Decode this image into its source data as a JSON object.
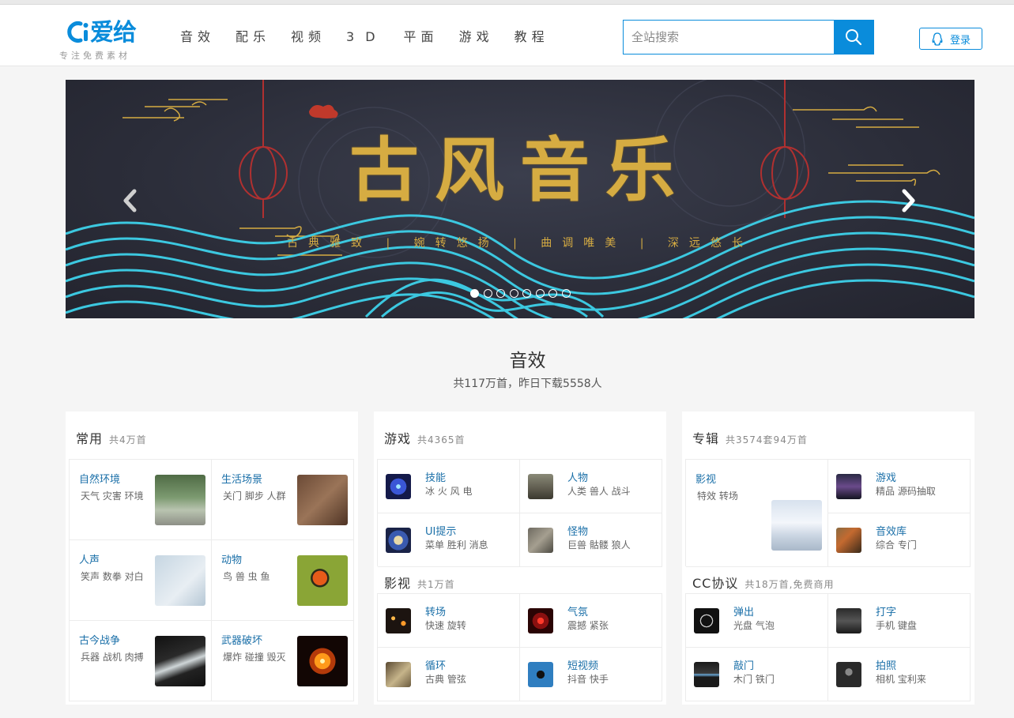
{
  "header": {
    "logo_text": "爱给",
    "logo_tagline": "专注免费素材",
    "nav": [
      "音效",
      "配乐",
      "视频",
      "3D",
      "平面",
      "游戏",
      "教程"
    ],
    "search_placeholder": "全站搜索",
    "login_label": "登录"
  },
  "banner": {
    "title": "古风音乐",
    "subtitle": "古典雅致 | 婉转悠扬 | 曲调唯美 | 深远悠长",
    "slide_count": 8,
    "active_slide": 1
  },
  "section": {
    "title": "音效",
    "stats": "共117万首，昨日下载5558人"
  },
  "panels": [
    {
      "heading": "常用",
      "count": "共4万首",
      "items": [
        {
          "title": "自然环境",
          "tags": "天气 灾害 环境",
          "icon": "forest-path-thumb"
        },
        {
          "title": "生活场景",
          "tags": "关门 脚步 人群",
          "icon": "footsteps-thumb"
        },
        {
          "title": "人声",
          "tags": "笑声 数拳 对白",
          "icon": "voice-thumb"
        },
        {
          "title": "动物",
          "tags": "鸟 兽 虫 鱼",
          "icon": "ladybug-thumb"
        },
        {
          "title": "古今战争",
          "tags": "兵器 战机 肉搏",
          "icon": "blade-thumb"
        },
        {
          "title": "武器破坏",
          "tags": "爆炸 碰撞 毁灭",
          "icon": "explosion-thumb"
        }
      ]
    },
    {
      "heading": "游戏",
      "count": "共4365首",
      "items": [
        {
          "title": "技能",
          "tags": "冰 火 风 电",
          "icon": "skill-icon"
        },
        {
          "title": "人物",
          "tags": "人类 兽人 战斗",
          "icon": "character-icon"
        },
        {
          "title": "UI提示",
          "tags": "菜单 胜利 消息",
          "icon": "ui-icon"
        },
        {
          "title": "怪物",
          "tags": "巨兽 骷髅 狼人",
          "icon": "monster-icon"
        }
      ],
      "sub_heading": "影视",
      "sub_count": "共1万首",
      "sub_items": [
        {
          "title": "转场",
          "tags": "快速 旋转",
          "icon": "transition-icon"
        },
        {
          "title": "气氛",
          "tags": "震撼 紧张",
          "icon": "atmosphere-icon"
        },
        {
          "title": "循环",
          "tags": "古典 管弦",
          "icon": "loop-icon"
        },
        {
          "title": "短视频",
          "tags": "抖音 快手",
          "icon": "short-video-icon"
        }
      ]
    },
    {
      "heading": "专辑",
      "count": "共3574套94万首",
      "feature": {
        "title": "影视",
        "tags": "特效 转场",
        "icon": "snow-scene-thumb"
      },
      "items": [
        {
          "title": "游戏",
          "tags": "精品 源码抽取",
          "icon": "game-album-icon"
        },
        {
          "title": "音效库",
          "tags": "综合 专门",
          "icon": "sound-library-icon"
        }
      ],
      "sub_heading": "CC协议",
      "sub_count": "共18万首,免费商用",
      "sub_items": [
        {
          "title": "弹出",
          "tags": "光盘 气泡",
          "icon": "popup-icon"
        },
        {
          "title": "打字",
          "tags": "手机 键盘",
          "icon": "typing-icon"
        },
        {
          "title": "敲门",
          "tags": "木门 铁门",
          "icon": "knock-icon"
        },
        {
          "title": "拍照",
          "tags": "相机 宝利来",
          "icon": "camera-icon"
        }
      ]
    }
  ],
  "colors": {
    "brand": "#0a8cdb",
    "banner_gold": "#d6ac42",
    "banner_wave": "#3cc8e0",
    "link": "#1a6fa8"
  }
}
